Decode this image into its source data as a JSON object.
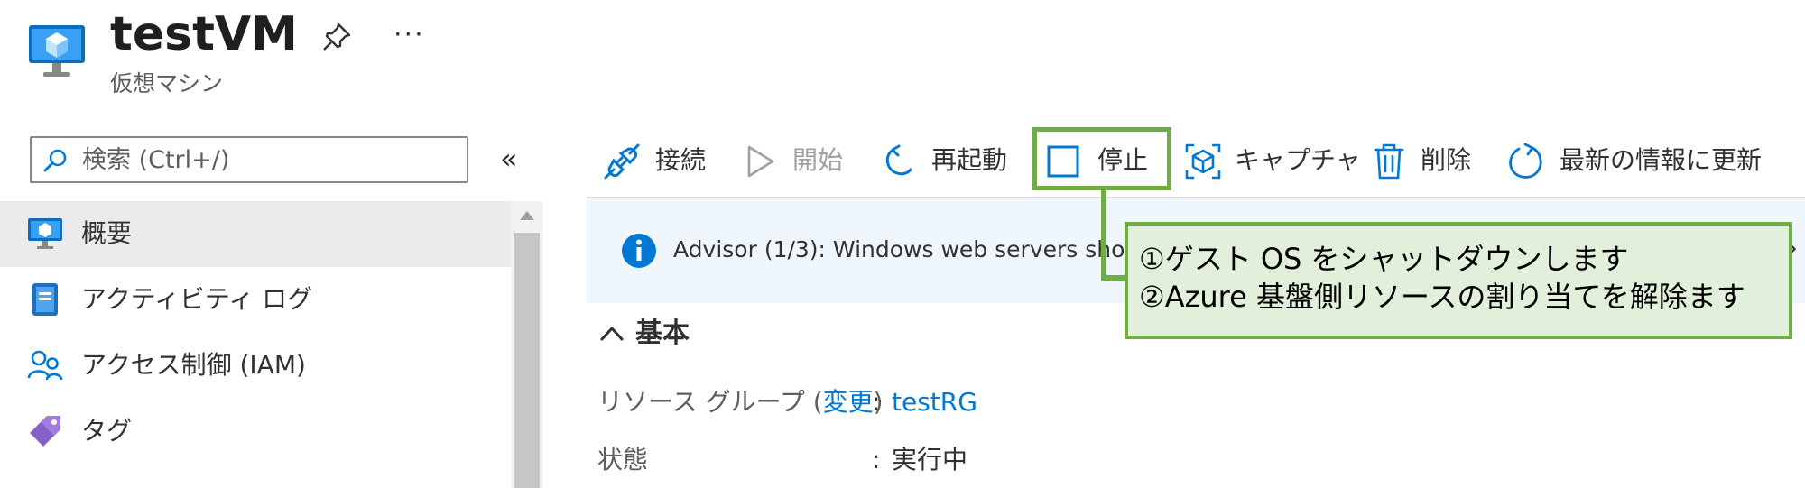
{
  "header": {
    "title": "testVM",
    "subtitle": "仮想マシン",
    "more_label": "···"
  },
  "search": {
    "placeholder": "検索 (Ctrl+/)"
  },
  "sidebar": {
    "collapse_label": "«",
    "items": [
      {
        "label": "概要",
        "icon": "vm-icon",
        "selected": true
      },
      {
        "label": "アクティビティ ログ",
        "icon": "activity-log-icon"
      },
      {
        "label": "アクセス制御 (IAM)",
        "icon": "iam-icon"
      },
      {
        "label": "タグ",
        "icon": "tag-icon"
      }
    ]
  },
  "toolbar": {
    "connect": "接続",
    "start": "開始",
    "restart": "再起動",
    "stop": "停止",
    "capture": "キャプチャ",
    "delete": "削除",
    "refresh": "最新の情報に更新"
  },
  "advisor": {
    "text": "Advisor (1/3): Windows web servers shou",
    "arrow": "›"
  },
  "essentials": {
    "header": "基本",
    "rows": [
      {
        "label": "リソース グループ (",
        "link": "変更",
        "suffix": ")",
        "colon": ":",
        "value": "testRG"
      },
      {
        "label": "状態",
        "colon": ":",
        "value": "実行中"
      }
    ]
  },
  "callout": {
    "line1": "①ゲスト OS をシャットダウンします",
    "line2": "②Azure 基盤側リソースの割り当てを解除ます"
  },
  "colors": {
    "accent": "#0078d4",
    "callout_border": "#70ad47",
    "callout_fill": "#e2efda",
    "banner_fill": "#eff6fc"
  }
}
